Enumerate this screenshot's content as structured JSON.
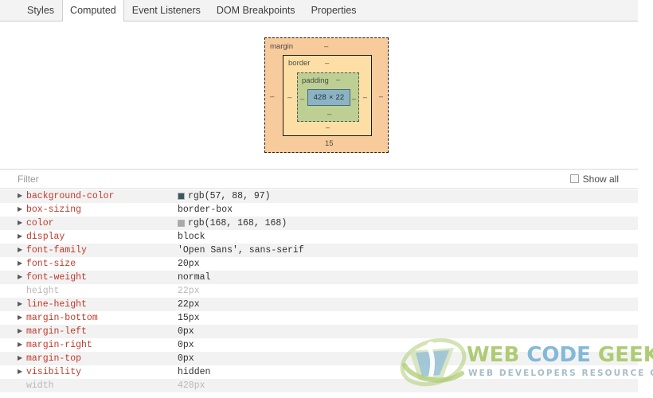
{
  "tabs": [
    {
      "label": "Styles",
      "selected": false
    },
    {
      "label": "Computed",
      "selected": true
    },
    {
      "label": "Event Listeners",
      "selected": false
    },
    {
      "label": "DOM Breakpoints",
      "selected": false
    },
    {
      "label": "Properties",
      "selected": false
    }
  ],
  "box_model": {
    "margin": {
      "label": "margin",
      "top": "–",
      "right": "–",
      "bottom": "15",
      "left": "–"
    },
    "border": {
      "label": "border",
      "top": "–",
      "right": "–",
      "bottom": "–",
      "left": "–"
    },
    "padding": {
      "label": "padding",
      "top": "–",
      "right": "–",
      "bottom": "–",
      "left": "–"
    },
    "content": {
      "size": "428 × 22"
    },
    "colors": {
      "margin": "#f8cb9c",
      "border": "#fddfa5",
      "padding": "#bdcf93",
      "content": "#8cb3c4"
    }
  },
  "filter": {
    "value": "",
    "placeholder": "Filter",
    "show_all_label": "Show all",
    "show_all_checked": false
  },
  "properties": [
    {
      "name": "background-color",
      "value": "rgb(57, 88, 97)",
      "swatch": "#395861",
      "expandable": true,
      "inherited": false
    },
    {
      "name": "box-sizing",
      "value": "border-box",
      "swatch": null,
      "expandable": true,
      "inherited": false
    },
    {
      "name": "color",
      "value": "rgb(168, 168, 168)",
      "swatch": "#a8a8a8",
      "expandable": true,
      "inherited": false
    },
    {
      "name": "display",
      "value": "block",
      "swatch": null,
      "expandable": true,
      "inherited": false
    },
    {
      "name": "font-family",
      "value": "'Open Sans', sans-serif",
      "swatch": null,
      "expandable": true,
      "inherited": false
    },
    {
      "name": "font-size",
      "value": "20px",
      "swatch": null,
      "expandable": true,
      "inherited": false
    },
    {
      "name": "font-weight",
      "value": "normal",
      "swatch": null,
      "expandable": true,
      "inherited": false
    },
    {
      "name": "height",
      "value": "22px",
      "swatch": null,
      "expandable": false,
      "inherited": true
    },
    {
      "name": "line-height",
      "value": "22px",
      "swatch": null,
      "expandable": true,
      "inherited": false
    },
    {
      "name": "margin-bottom",
      "value": "15px",
      "swatch": null,
      "expandable": true,
      "inherited": false
    },
    {
      "name": "margin-left",
      "value": "0px",
      "swatch": null,
      "expandable": true,
      "inherited": false
    },
    {
      "name": "margin-right",
      "value": "0px",
      "swatch": null,
      "expandable": true,
      "inherited": false
    },
    {
      "name": "margin-top",
      "value": "0px",
      "swatch": null,
      "expandable": true,
      "inherited": false
    },
    {
      "name": "visibility",
      "value": "hidden",
      "swatch": null,
      "expandable": true,
      "inherited": false
    },
    {
      "name": "width",
      "value": "428px",
      "swatch": null,
      "expandable": false,
      "inherited": true
    }
  ],
  "watermark": {
    "word1": "WEB",
    "word2": "CODE",
    "word3": "GEEKS",
    "tagline": "WEB DEVELOPERS RESOURCE CENTER",
    "color_green": "#a9c86a",
    "color_blue": "#79b4d6"
  }
}
